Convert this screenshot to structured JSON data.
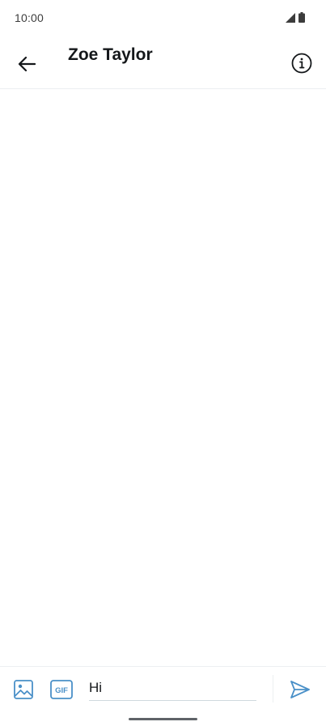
{
  "status_bar": {
    "time": "10:00",
    "icons": [
      "signal-icon",
      "battery-icon"
    ]
  },
  "header": {
    "title": "Zoe Taylor",
    "back_icon": "arrow-left-icon",
    "info_icon": "info-icon"
  },
  "composer": {
    "media_icon": "image-icon",
    "gif_label": "GIF",
    "input_value": "Hi",
    "send_icon": "send-icon"
  },
  "colors": {
    "accent": "#4a90c8",
    "text": "#14171a",
    "divider": "#eceff1"
  }
}
